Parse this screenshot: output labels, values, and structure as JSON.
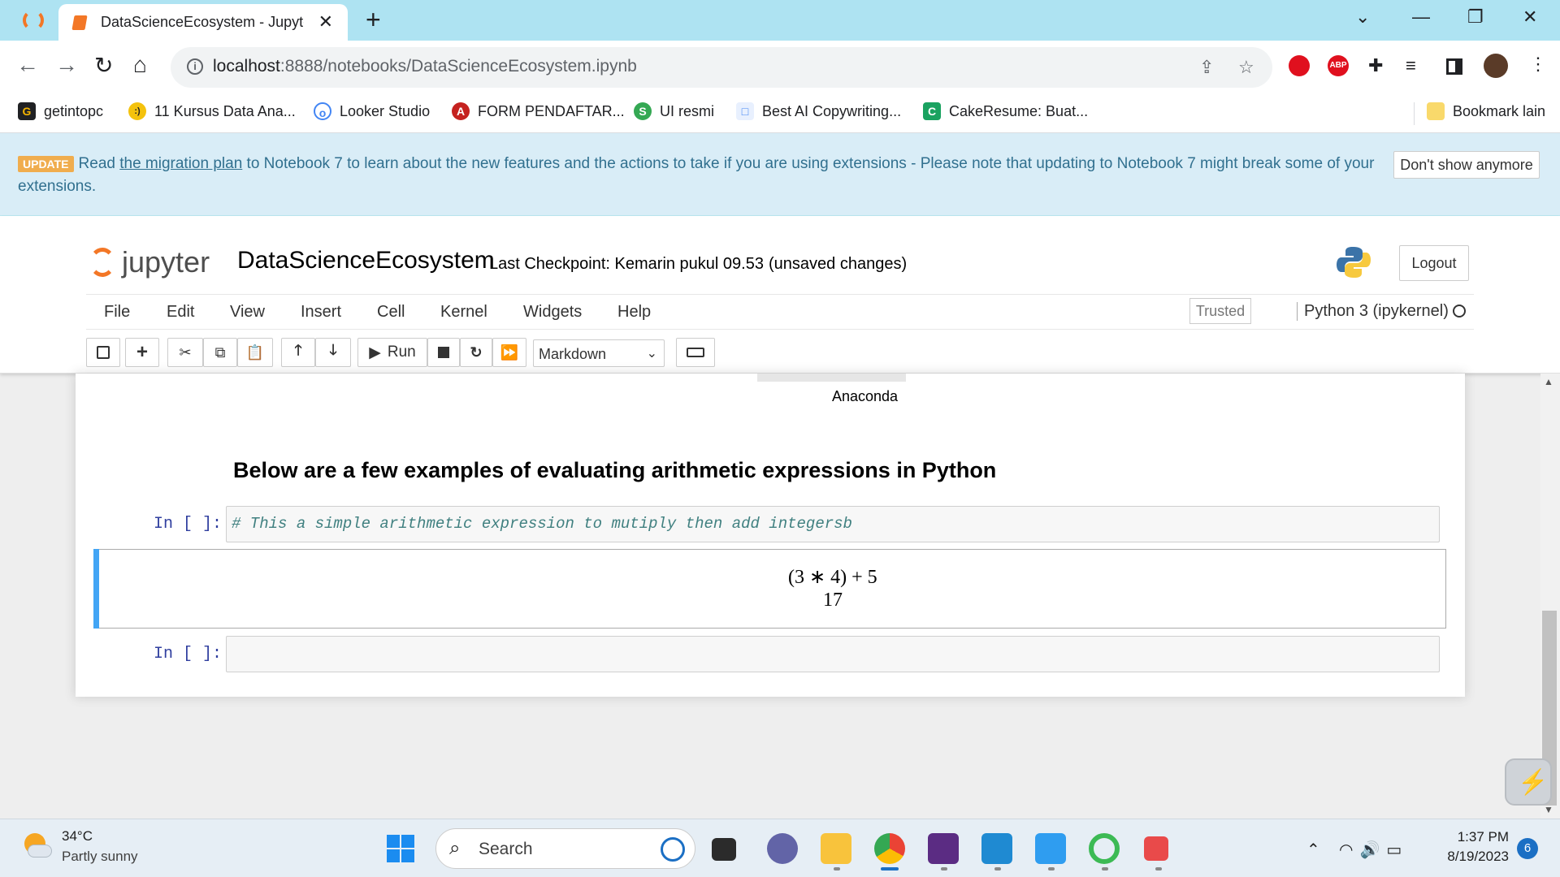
{
  "browser": {
    "tab_title": "DataScienceEcosystem - Jupyter N",
    "url_host": "localhost",
    "url_path": ":8888/notebooks/DataScienceEcosystem.ipynb",
    "new_tab_glyph": "+",
    "bookmarks": [
      {
        "label": "getintopc",
        "icon_color": "#f4b400",
        "icon_letter": "G"
      },
      {
        "label": "11 Kursus Data Ana...",
        "icon_color": "#f4c20d",
        "icon_letter": ":)"
      },
      {
        "label": "Looker Studio",
        "icon_color": "#4285f4",
        "icon_letter": "o"
      },
      {
        "label": "FORM PENDAFTAR...",
        "icon_color": "#c5221f",
        "icon_letter": "A"
      },
      {
        "label": "UI resmi",
        "icon_color": "#34a853",
        "icon_letter": "S"
      },
      {
        "label": "Best AI Copywriting...",
        "icon_color": "#4285f4",
        "icon_letter": "□"
      },
      {
        "label": "CakeResume: Buat...",
        "icon_color": "#1aa260",
        "icon_letter": "C"
      }
    ],
    "other_bookmarks": "Bookmark lain"
  },
  "banner": {
    "badge": "UPDATE",
    "text_before": "Read ",
    "link": "the migration plan",
    "text_after": " to Notebook 7 to learn about the new features and the actions to take if you are using extensions - Please note that updating to Notebook 7 might break some of your extensions.",
    "dismiss": "Don't show anymore"
  },
  "jupyter": {
    "logo_text": "jupyter",
    "notebook_name": "DataScienceEcosystem",
    "checkpoint": "Last Checkpoint: Kemarin pukul 09.53",
    "unsaved": "(unsaved changes)",
    "logout": "Logout",
    "menu": [
      "File",
      "Edit",
      "View",
      "Insert",
      "Cell",
      "Kernel",
      "Widgets",
      "Help"
    ],
    "trusted": "Trusted",
    "kernel": "Python 3 (ipykernel)",
    "run_label": "Run",
    "cell_type": "Markdown"
  },
  "notebook": {
    "image_caption": "Anaconda",
    "heading": "Below are a few examples of evaluating arithmetic expressions in Python",
    "cell1_prompt": "In [ ]:",
    "cell1_code": "# This a simple arithmetic expression to mutiply then add integersb",
    "math_line1": "(3 ∗ 4) + 5",
    "math_line2": "17",
    "cell2_prompt": "In [ ]:",
    "cell2_code": ""
  },
  "taskbar": {
    "temperature": "34°C",
    "condition": "Partly sunny",
    "search_label": "Search",
    "time": "1:37 PM",
    "date": "8/19/2023",
    "notification_count": "6"
  },
  "colors": {
    "tabstrip": "#aee3f2",
    "jupyter_orange": "#f37726",
    "selected_cell_bar": "#42a5f5",
    "prompt_blue": "#303f9f"
  }
}
